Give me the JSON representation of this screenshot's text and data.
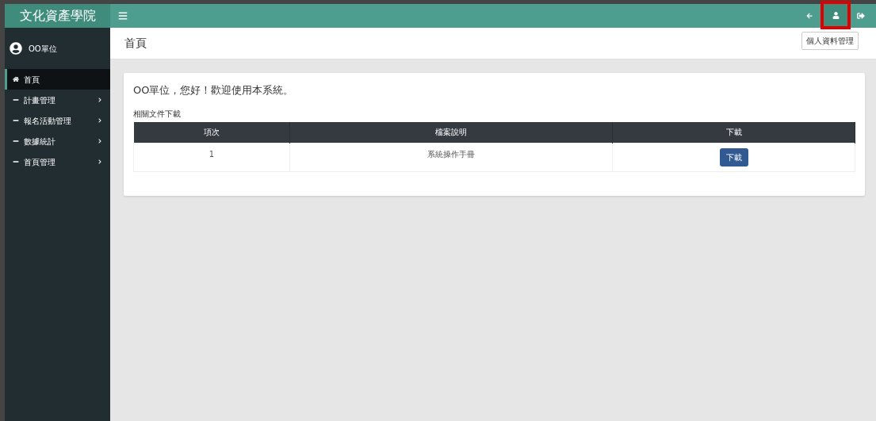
{
  "brand": "文化資產學院",
  "user": {
    "name": "OO單位"
  },
  "menu": [
    {
      "label": "首頁",
      "kind": "home",
      "selected": true,
      "has_submenu": false
    },
    {
      "label": "計畫管理",
      "kind": "dash",
      "selected": false,
      "has_submenu": true
    },
    {
      "label": "報名活動管理",
      "kind": "dash",
      "selected": false,
      "has_submenu": true
    },
    {
      "label": "數據統計",
      "kind": "dash",
      "selected": false,
      "has_submenu": true
    },
    {
      "label": "首頁管理",
      "kind": "dash",
      "selected": false,
      "has_submenu": true
    }
  ],
  "page_title": "首頁",
  "tooltip": "個人資料管理",
  "welcome": "OO單位，您好！歡迎使用本系統。",
  "section_title": "相關文件下載",
  "table": {
    "columns": [
      "項次",
      "檔案說明",
      "下載"
    ],
    "rows": [
      {
        "index": "1",
        "description": "系統操作手冊",
        "button": "下載"
      }
    ]
  }
}
